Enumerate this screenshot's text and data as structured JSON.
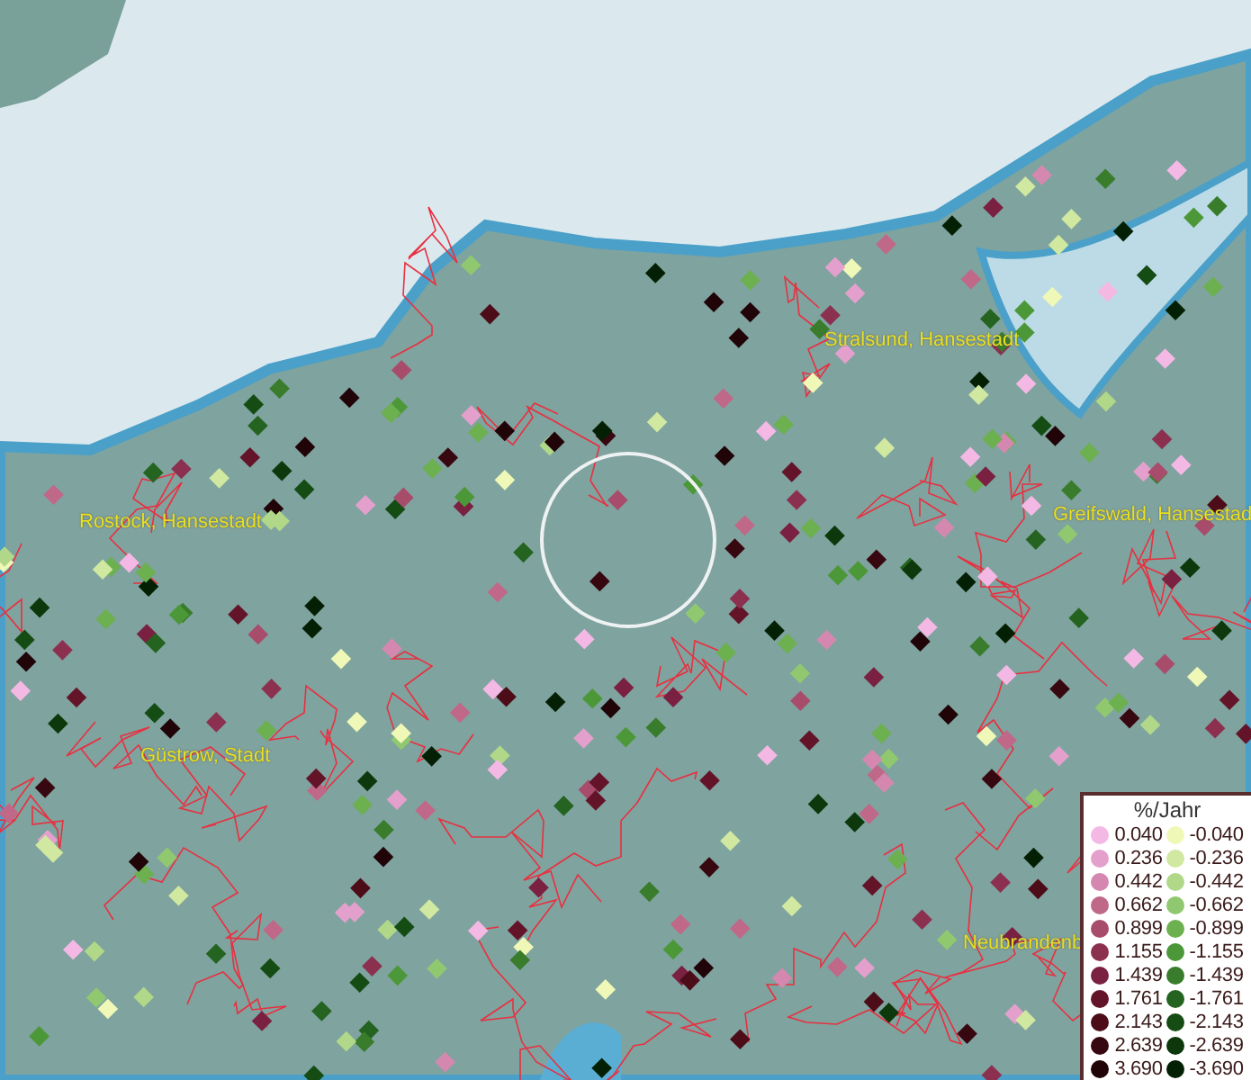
{
  "map": {
    "places": [
      {
        "label": "Rostock, Hansestadt"
      },
      {
        "label": "Stralsund, Hansestadt"
      },
      {
        "label": "Greifswald, Hansestad"
      },
      {
        "label": "Güstrow, Stadt"
      },
      {
        "label": "Neubrandenb"
      }
    ]
  },
  "legend": {
    "title": "%/Jahr",
    "rows": [
      {
        "left": {
          "label": "0.040",
          "color": "#f4b8e4"
        },
        "right": {
          "label": "-0.040",
          "color": "#f0f8b8"
        }
      },
      {
        "left": {
          "label": "0.236",
          "color": "#e4a0cc"
        },
        "right": {
          "label": "-0.236",
          "color": "#d0e8a0"
        }
      },
      {
        "left": {
          "label": "0.442",
          "color": "#d488b0"
        },
        "right": {
          "label": "-0.442",
          "color": "#b0d888"
        }
      },
      {
        "left": {
          "label": "0.662",
          "color": "#c06888"
        },
        "right": {
          "label": "-0.662",
          "color": "#90c870"
        }
      },
      {
        "left": {
          "label": "0.899",
          "color": "#a84c6c"
        },
        "right": {
          "label": "-0.899",
          "color": "#6cb050"
        }
      },
      {
        "left": {
          "label": "1.155",
          "color": "#8c3050"
        },
        "right": {
          "label": "-1.155",
          "color": "#4c9838"
        }
      },
      {
        "left": {
          "label": "1.439",
          "color": "#7a2040"
        },
        "right": {
          "label": "-1.439",
          "color": "#387c2c"
        }
      },
      {
        "left": {
          "label": "1.761",
          "color": "#641428"
        },
        "right": {
          "label": "-1.761",
          "color": "#246420"
        }
      },
      {
        "left": {
          "label": "2.143",
          "color": "#4c0c18"
        },
        "right": {
          "label": "-2.143",
          "color": "#144c14"
        }
      },
      {
        "left": {
          "label": "2.639",
          "color": "#380810"
        },
        "right": {
          "label": "-2.639",
          "color": "#0c380c"
        }
      },
      {
        "left": {
          "label": "3.690",
          "color": "#200408"
        },
        "right": {
          "label": "-3.690",
          "color": "#042004"
        }
      }
    ]
  }
}
